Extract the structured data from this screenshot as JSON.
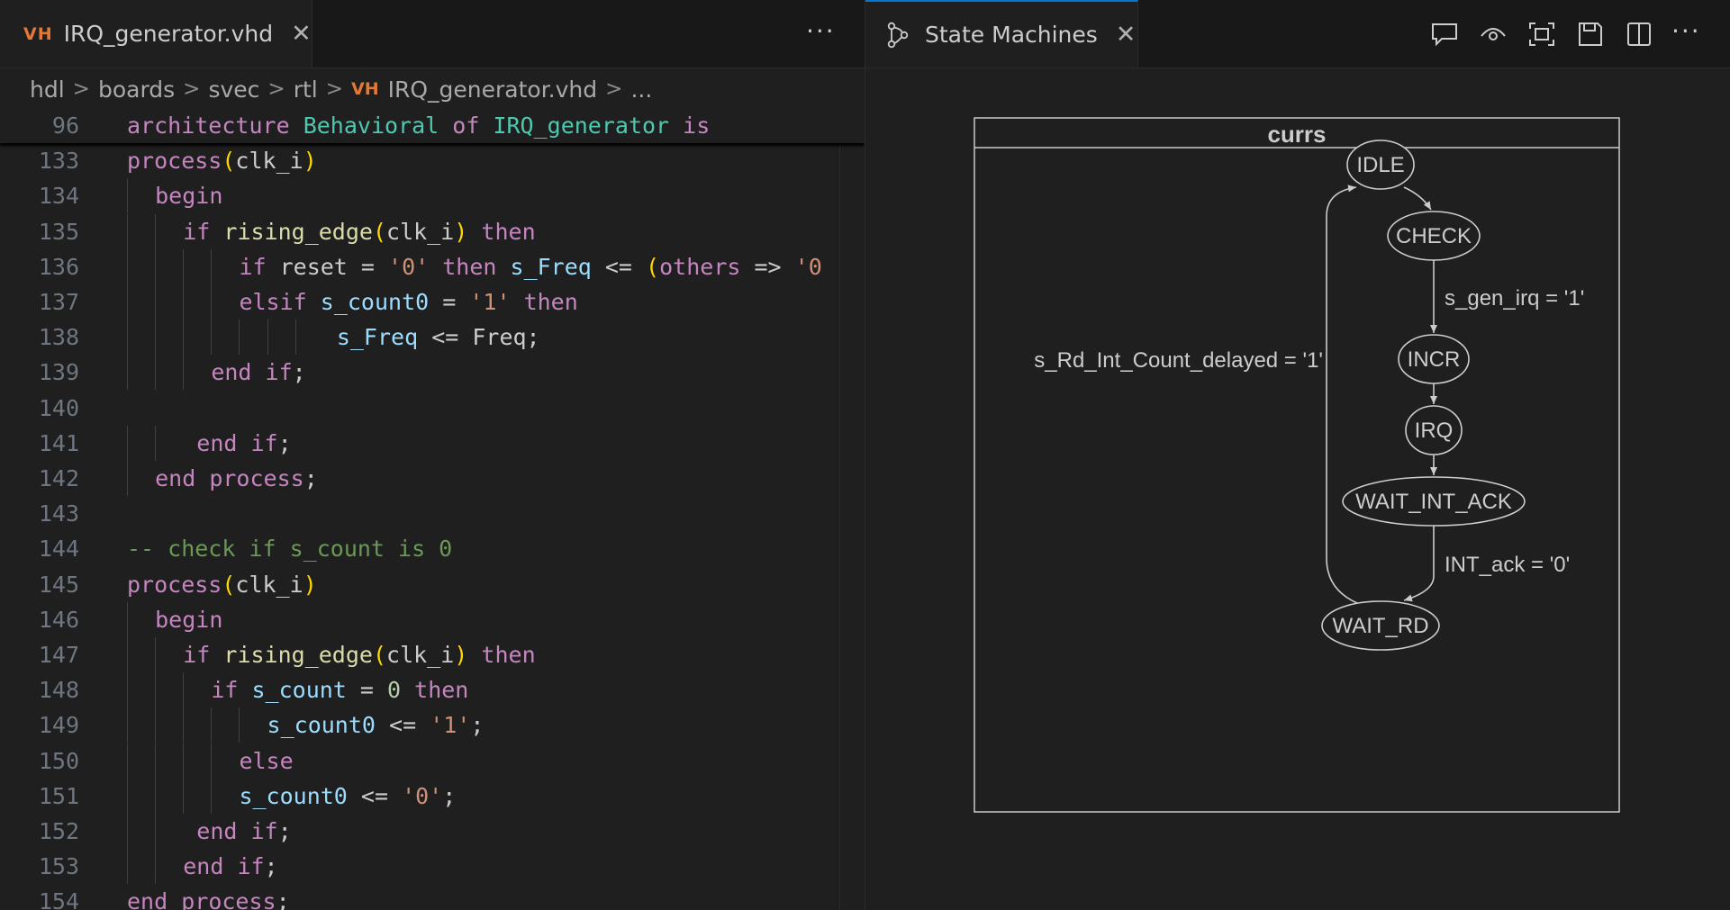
{
  "left_tab": {
    "icon_text": "VH",
    "title": "IRQ_generator.vhd",
    "close_symbol": "✕"
  },
  "left_more": "···",
  "breadcrumb": [
    "hdl",
    "boards",
    "svec",
    "rtl"
  ],
  "breadcrumb_file": {
    "icon_text": "VH",
    "name": "IRQ_generator.vhd"
  },
  "breadcrumb_tail": "...",
  "breadcrumb_sep": ">",
  "code_lines": [
    {
      "ln": "96",
      "text": "architecture Behavioral of IRQ_generator is"
    },
    {
      "ln": "133",
      "text": "process(clk_i)"
    },
    {
      "ln": "134",
      "text": "  begin"
    },
    {
      "ln": "135",
      "text": "    if rising_edge(clk_i) then"
    },
    {
      "ln": "136",
      "text": "        if reset = '0' then s_Freq <= (others => '0"
    },
    {
      "ln": "137",
      "text": "        elsif s_count0 = '1' then"
    },
    {
      "ln": "138",
      "text": "               s_Freq <= Freq;"
    },
    {
      "ln": "139",
      "text": "      end if;"
    },
    {
      "ln": "140",
      "text": ""
    },
    {
      "ln": "141",
      "text": "     end if;"
    },
    {
      "ln": "142",
      "text": "  end process;"
    },
    {
      "ln": "143",
      "text": ""
    },
    {
      "ln": "144",
      "text": "-- check if s_count is 0"
    },
    {
      "ln": "145",
      "text": "process(clk_i)"
    },
    {
      "ln": "146",
      "text": "  begin"
    },
    {
      "ln": "147",
      "text": "    if rising_edge(clk_i) then"
    },
    {
      "ln": "148",
      "text": "      if s_count = 0 then"
    },
    {
      "ln": "149",
      "text": "          s_count0 <= '1';"
    },
    {
      "ln": "150",
      "text": "        else"
    },
    {
      "ln": "151",
      "text": "        s_count0 <= '0';"
    },
    {
      "ln": "152",
      "text": "     end if;"
    },
    {
      "ln": "153",
      "text": "    end if;"
    },
    {
      "ln": "154",
      "text": "end process;"
    }
  ],
  "right_tab": {
    "title": "State Machines",
    "close_symbol": "✕",
    "icon": "state-machine-icon"
  },
  "right_actions": [
    "comment-icon",
    "eye-icon",
    "fit-screen-icon",
    "save-icon",
    "split-editor-icon",
    "more-icon"
  ],
  "right_more": "···",
  "colors": {
    "keyword": "#c586c0",
    "type": "#4ec9b0",
    "function": "#dcdcaa",
    "variable": "#9cdcfe",
    "string": "#ce9178",
    "number": "#b5cea8",
    "comment": "#6a9955",
    "bracket_1": "#ffd700",
    "bracket_2": "#da70d6",
    "vh_badge": "#e37933",
    "active_tab_border": "#0078d4"
  },
  "fsm": {
    "cluster_label": "currs",
    "states": [
      {
        "id": "IDLE",
        "label": "IDLE"
      },
      {
        "id": "CHECK",
        "label": "CHECK"
      },
      {
        "id": "INCR",
        "label": "INCR"
      },
      {
        "id": "IRQ",
        "label": "IRQ"
      },
      {
        "id": "WAIT_INT_ACK",
        "label": "WAIT_INT_ACK"
      },
      {
        "id": "WAIT_RD",
        "label": "WAIT_RD"
      }
    ],
    "transitions": [
      {
        "from": "IDLE",
        "to": "CHECK",
        "label": ""
      },
      {
        "from": "CHECK",
        "to": "INCR",
        "label": "s_gen_irq = '1'"
      },
      {
        "from": "INCR",
        "to": "IRQ",
        "label": ""
      },
      {
        "from": "IRQ",
        "to": "WAIT_INT_ACK",
        "label": ""
      },
      {
        "from": "WAIT_INT_ACK",
        "to": "WAIT_RD",
        "label": "INT_ack = '0'"
      },
      {
        "from": "WAIT_RD",
        "to": "IDLE",
        "label": "s_Rd_Int_Count_delayed = '1'"
      }
    ]
  }
}
